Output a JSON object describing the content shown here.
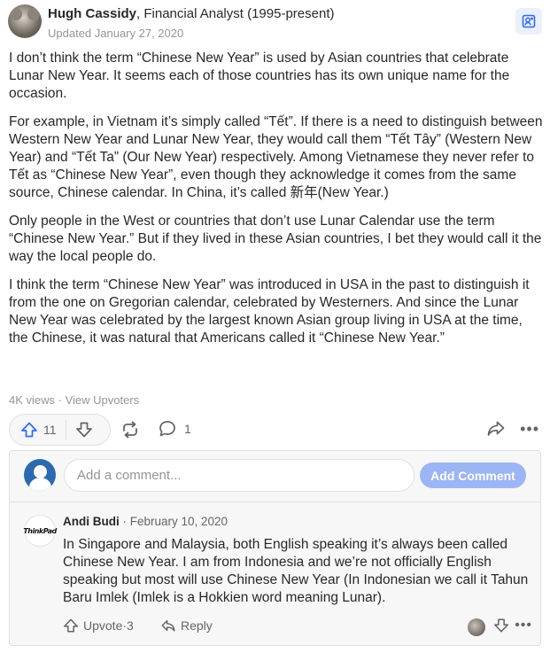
{
  "author": {
    "name": "Hugh Cassidy",
    "credential": ", Financial Analyst (1995-present)",
    "updated": "Updated January 27, 2020"
  },
  "answer": {
    "paragraphs": [
      "I don’t think the term “Chinese New Year” is used by Asian countries that celebrate Lunar New Year. It seems each of those countries has its own unique name for the occasion.",
      "For example, in Vietnam it’s simply called “Tết”. If there is a need to distinguish between Western New Year and Lunar New Year, they would call them “Tết Tây” (Western New Year) and “Tết Ta” (Our New Year) respectively. Among Vietnamese they never refer to Tết as “Chinese New Year”, even though they acknowledge it comes from the same source, Chinese calendar. In China, it’s called 新年(New Year.)",
      "Only people in the West or countries that don’t use Lunar Calendar use the term “Chinese New Year.” But if they lived in these Asian countries, I bet they would call it the way the local people do.",
      "I think the term “Chinese New Year” was introduced in USA in the past to distinguish it from the one on Gregorian calendar, celebrated by Westerners. And since the Lunar New Year was celebrated by the largest known Asian group living in USA at the time, the Chinese, it was natural that Americans called it “Chinese New Year.”"
    ]
  },
  "meta": {
    "views": "4K views",
    "separator": " · ",
    "upvoters_link": "View Upvoters"
  },
  "actions": {
    "upvote_count": "11",
    "comment_count": "1",
    "more": "•••"
  },
  "add_comment": {
    "placeholder": "Add a comment...",
    "button_label": "Add Comment"
  },
  "comment": {
    "avatar_text": "ThinkPad",
    "author": "Andi Budi",
    "separator": " · ",
    "date": "February 10, 2020",
    "text": "In Singapore and Malaysia, both English speaking it’s always been called Chinese New Year. I am from Indonesia and we’re not officially English speaking but most will use Chinese New Year (In Indonesian we call it Tahun Baru Imlek (Imlek is a Hokkien word meaning Lunar).",
    "upvote_label": "Upvote",
    "upvote_separator": " · ",
    "upvote_count": "3",
    "reply_label": "Reply",
    "more": "•••"
  },
  "colors": {
    "accent": "#2e69ff",
    "button_disabled": "#9cb5f4",
    "muted_text": "#939598",
    "panel_bg": "#f7f7f8"
  }
}
